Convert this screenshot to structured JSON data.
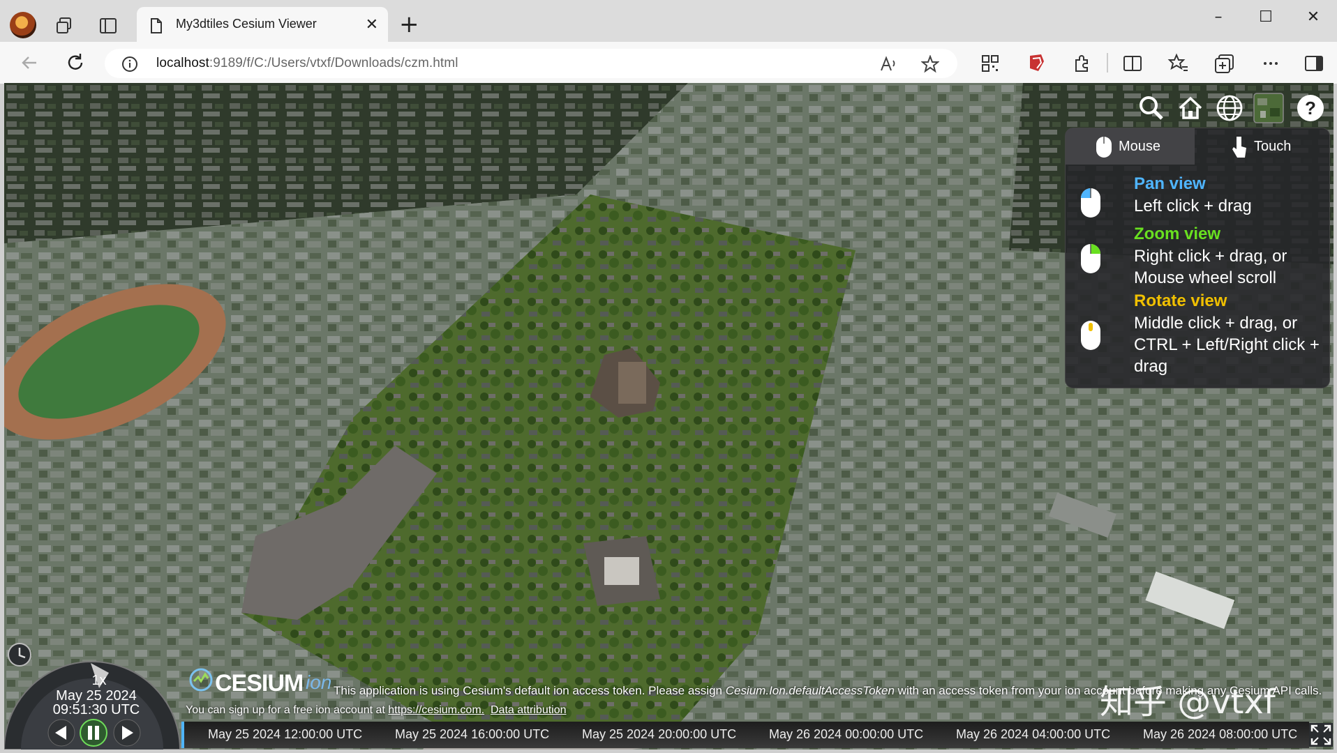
{
  "browser": {
    "tab_title": "My3dtiles Cesium Viewer",
    "url_host": "localhost",
    "url_rest": ":9189/f/C:/Users/vtxf/Downloads/czm.html"
  },
  "navigation_help": {
    "tabs": [
      "Mouse",
      "Touch"
    ],
    "items": [
      {
        "title": "Pan view",
        "desc": "Left click + drag",
        "color": "#4fb5ff"
      },
      {
        "title": "Zoom view",
        "desc": "Right click + drag, or\nMouse wheel scroll",
        "color": "#69e020"
      },
      {
        "title": "Rotate view",
        "desc": "Middle click + drag, or\nCTRL + Left/Right click +\ndrag",
        "color": "#f0c000"
      }
    ]
  },
  "animation": {
    "speed": "1x",
    "date": "May 25 2024",
    "time": "09:51:30 UTC"
  },
  "credits": {
    "logo": "CESIUM",
    "logo_ion": "ion",
    "notice_prefix": "This application is using Cesium's default ion access token. Please assign ",
    "notice_token": "Cesium.Ion.defaultAccessToken",
    "notice_suffix": " with an access token from your ion account before making any Cesium API calls.",
    "signup_prefix": "You can sign up for a free ion account at ",
    "signup_link": "https://cesium.com.",
    "attribution": "Data attribution"
  },
  "timeline": {
    "ticks": [
      "May 25 2024 12:00:00 UTC",
      "May 25 2024 16:00:00 UTC",
      "May 25 2024 20:00:00 UTC",
      "May 26 2024 00:00:00 UTC",
      "May 26 2024 04:00:00 UTC",
      "May 26 2024 08:00:00 UTC"
    ]
  },
  "watermark": "知乎 @vtxf"
}
